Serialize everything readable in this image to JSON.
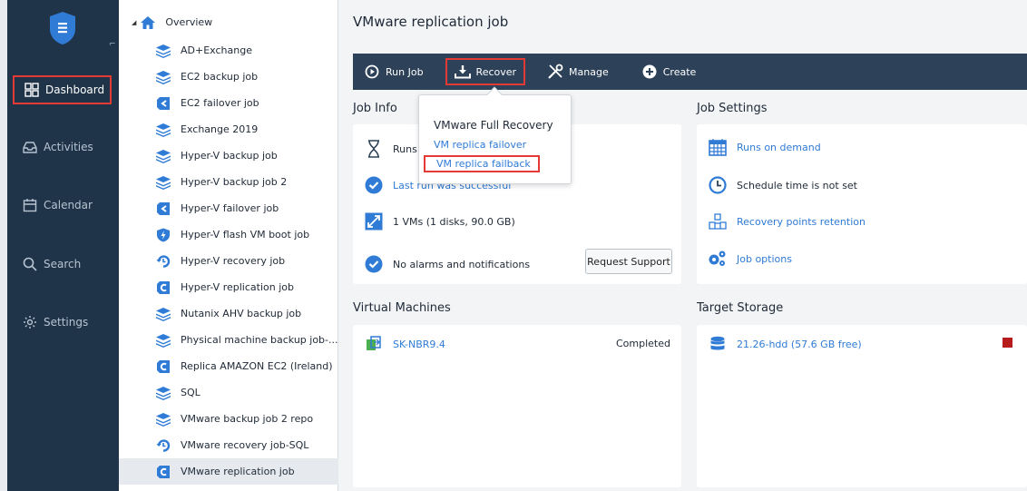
{
  "nav": {
    "items": [
      {
        "label": "Dashboard",
        "icon": "dashboard-icon",
        "active": true
      },
      {
        "label": "Activities",
        "icon": "activities-icon",
        "active": false
      },
      {
        "label": "Calendar",
        "icon": "calendar-icon",
        "active": false
      },
      {
        "label": "Search",
        "icon": "search-icon",
        "active": false
      },
      {
        "label": "Settings",
        "icon": "settings-icon",
        "active": false
      }
    ]
  },
  "tree": {
    "root": "Overview",
    "items": [
      {
        "label": "AD+Exchange",
        "type": "backup"
      },
      {
        "label": "EC2 backup job",
        "type": "backup"
      },
      {
        "label": "EC2 failover job",
        "type": "failover"
      },
      {
        "label": "Exchange 2019",
        "type": "backup"
      },
      {
        "label": "Hyper-V backup job",
        "type": "backup"
      },
      {
        "label": "Hyper-V backup job 2",
        "type": "backup"
      },
      {
        "label": "Hyper-V failover job",
        "type": "failover"
      },
      {
        "label": "Hyper-V flash VM boot job",
        "type": "flashboot"
      },
      {
        "label": "Hyper-V recovery job",
        "type": "recovery"
      },
      {
        "label": "Hyper-V replication job",
        "type": "replication"
      },
      {
        "label": "Nutanix AHV backup job",
        "type": "backup"
      },
      {
        "label": "Physical machine backup job-...",
        "type": "backup"
      },
      {
        "label": "Replica AMAZON EC2 (Ireland)",
        "type": "replication"
      },
      {
        "label": "SQL",
        "type": "backup"
      },
      {
        "label": "VMware backup job 2 repo",
        "type": "backup"
      },
      {
        "label": "VMware recovery job-SQL",
        "type": "recovery"
      },
      {
        "label": "VMware replication job",
        "type": "replication",
        "selected": true
      }
    ]
  },
  "main": {
    "title": "VMware replication job",
    "toolbar": {
      "run_job": "Run Job",
      "recover": "Recover",
      "manage": "Manage",
      "create": "Create"
    },
    "job_info": {
      "title": "Job Info",
      "runs": "Runs",
      "last_run": "Last run was successful",
      "vms": "1 VMs (1 disks, 90.0 GB)",
      "alarms": "No alarms and notifications",
      "request_support": "Request Support"
    },
    "job_settings": {
      "title": "Job Settings",
      "runs_on_demand": "Runs on demand",
      "schedule": "Schedule time is not set",
      "retention": "Recovery points retention",
      "options": "Job options"
    },
    "virtual_machines": {
      "title": "Virtual Machines",
      "vm_name": "SK-NBR9.4",
      "vm_status": "Completed"
    },
    "target_storage": {
      "title": "Target Storage",
      "storage": "21.26-hdd (57.6 GB free)"
    }
  },
  "popup": {
    "title": "VMware Full Recovery",
    "item1": "VM replica failover",
    "item2": "VM replica failback"
  },
  "colors": {
    "nav_bg": "#1f3449",
    "toolbar_bg": "#2d4158",
    "accent": "#2f7bd6",
    "highlight": "#e53935"
  }
}
